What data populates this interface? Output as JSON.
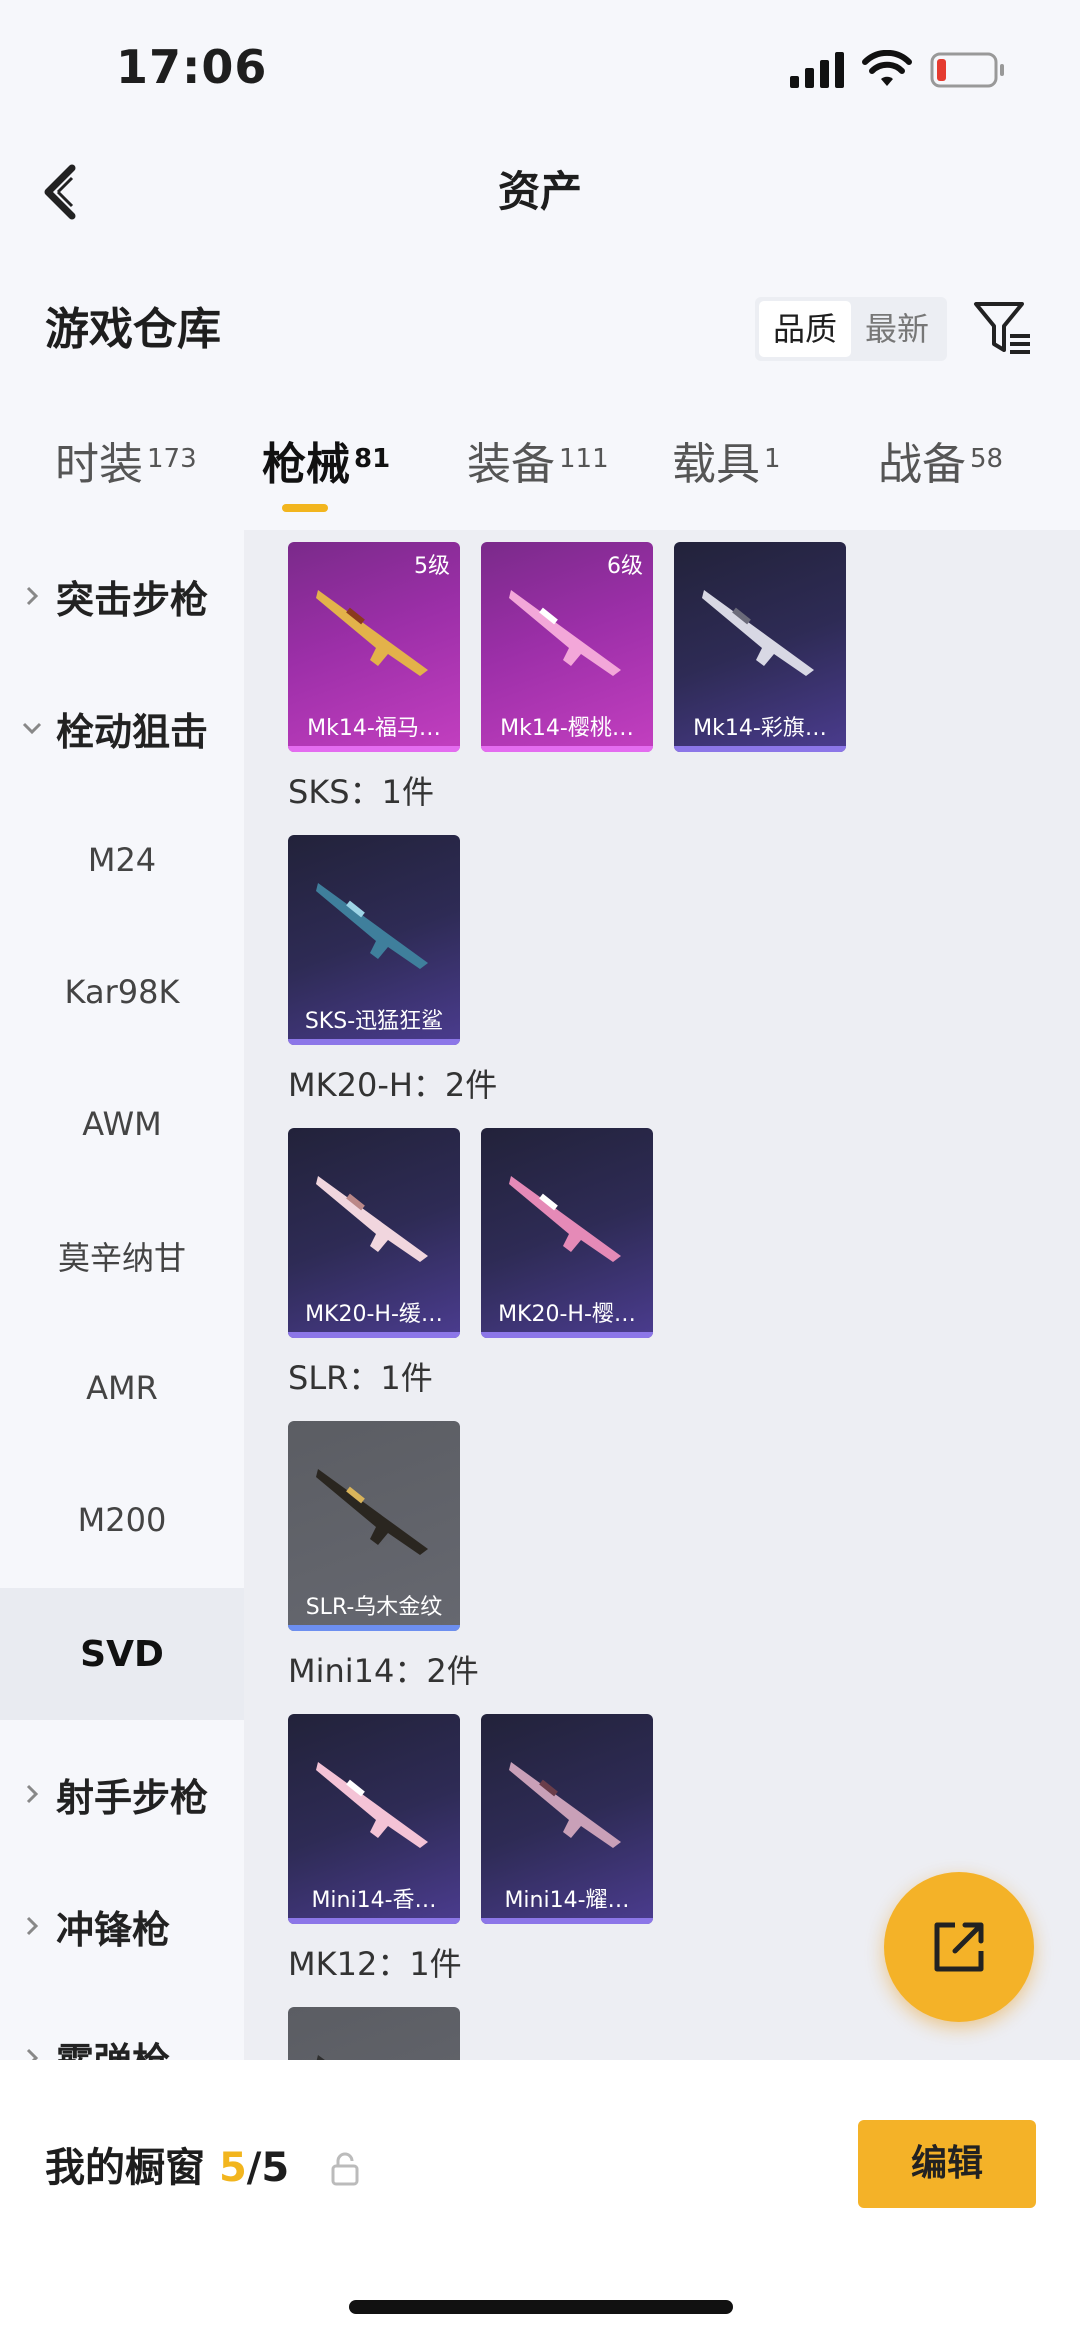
{
  "status": {
    "time": "17:06"
  },
  "header": {
    "title": "资产"
  },
  "warehouse": {
    "title": "游戏仓库",
    "sort": [
      "品质",
      "最新"
    ]
  },
  "tabs": [
    {
      "label": "时装",
      "count": "173"
    },
    {
      "label": "枪械",
      "count": "81"
    },
    {
      "label": "装备",
      "count": "111"
    },
    {
      "label": "载具",
      "count": "1"
    },
    {
      "label": "战备",
      "count": "58"
    }
  ],
  "sidebar": [
    {
      "label": "突击步枪",
      "type": "group",
      "expanded": false
    },
    {
      "label": "栓动狙击",
      "type": "group",
      "expanded": true
    },
    {
      "label": "M24",
      "type": "sub"
    },
    {
      "label": "Kar98K",
      "type": "sub"
    },
    {
      "label": "AWM",
      "type": "sub"
    },
    {
      "label": "莫辛纳甘",
      "type": "sub"
    },
    {
      "label": "AMR",
      "type": "sub"
    },
    {
      "label": "M200",
      "type": "sub"
    },
    {
      "label": "SVD",
      "type": "sub",
      "selected": true
    },
    {
      "label": "射手步枪",
      "type": "group",
      "expanded": false
    },
    {
      "label": "冲锋枪",
      "type": "group",
      "expanded": false
    },
    {
      "label": "霰弹枪",
      "type": "group",
      "expanded": false
    }
  ],
  "sections": [
    {
      "label": "",
      "items": [
        {
          "name": "Mk14-福马…",
          "level": "5级",
          "style": "pink"
        },
        {
          "name": "Mk14-樱桃…",
          "level": "6级",
          "style": "pink"
        },
        {
          "name": "Mk14-彩旗…",
          "level": "",
          "style": "purple"
        }
      ]
    },
    {
      "label": "SKS：1件",
      "items": [
        {
          "name": "SKS-迅猛狂鲨",
          "level": "",
          "style": "purple"
        }
      ]
    },
    {
      "label": "MK20-H：2件",
      "items": [
        {
          "name": "MK20-H-缓…",
          "level": "",
          "style": "purple"
        },
        {
          "name": "MK20-H-樱…",
          "level": "",
          "style": "purple"
        }
      ]
    },
    {
      "label": "SLR：1件",
      "items": [
        {
          "name": "SLR-乌木金纹",
          "level": "",
          "style": "gray"
        }
      ]
    },
    {
      "label": "Mini14：2件",
      "items": [
        {
          "name": "Mini14-香…",
          "level": "",
          "style": "purple"
        },
        {
          "name": "Mini14-耀…",
          "level": "",
          "style": "purple"
        }
      ]
    },
    {
      "label": "MK12：1件",
      "items": [
        {
          "name": "",
          "level": "",
          "style": "gray"
        }
      ]
    }
  ],
  "bottom": {
    "showcase_label": "我的橱窗",
    "count": "5",
    "total": "/5",
    "edit_label": "编辑"
  },
  "colors": {
    "accent": "#f4b228",
    "pink_card": "#9c2fa8",
    "purple_card": "#2e2b55",
    "gray_card": "#5b5d63"
  },
  "icons": [
    "back-icon",
    "filter-icon",
    "chevron-right-icon",
    "chevron-down-icon",
    "share-icon",
    "lock-icon"
  ]
}
